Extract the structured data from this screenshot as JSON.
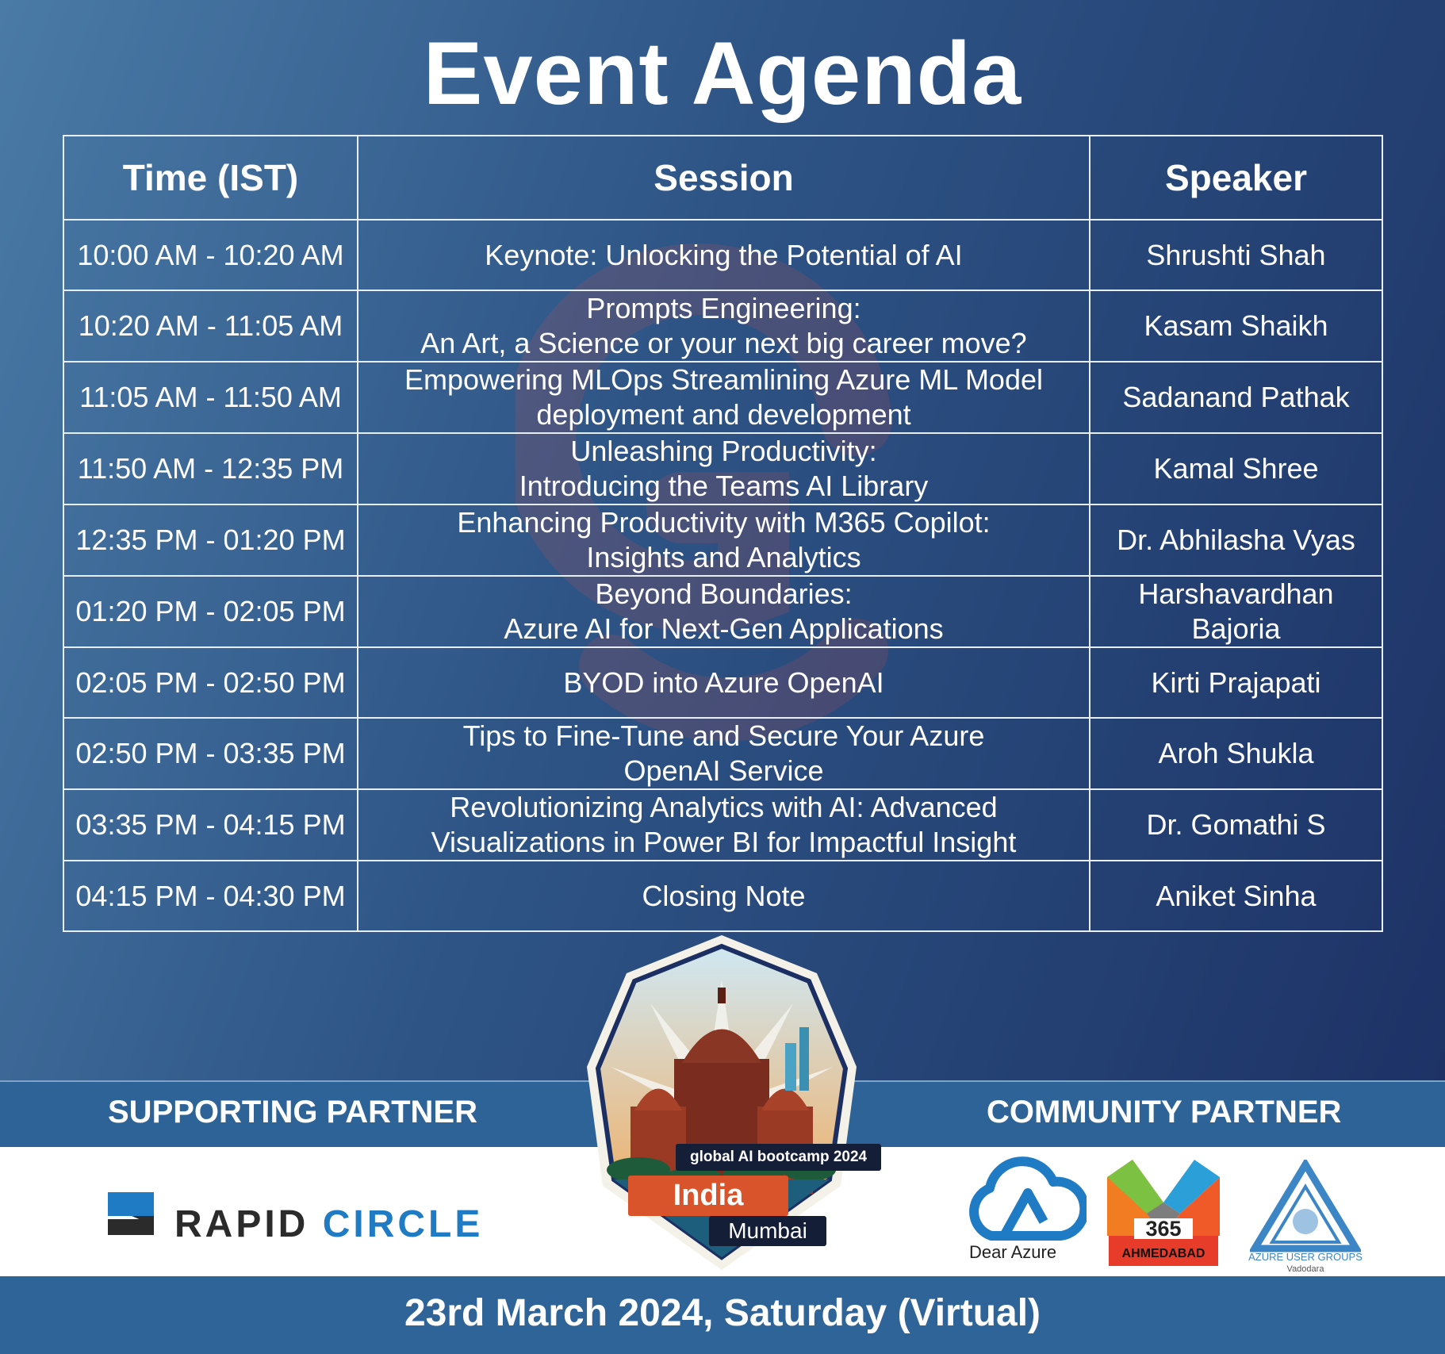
{
  "header": {
    "title": "Event Agenda"
  },
  "table": {
    "columns": [
      "Time (IST)",
      "Session",
      "Speaker"
    ],
    "rows": [
      {
        "time": "10:00 AM - 10:20 AM",
        "session": [
          "Keynote: Unlocking the Potential of AI"
        ],
        "speaker": [
          "Shrushti Shah"
        ]
      },
      {
        "time": "10:20 AM - 11:05 AM",
        "session": [
          "Prompts Engineering:",
          "An Art, a Science or your next big career move?"
        ],
        "speaker": [
          "Kasam Shaikh"
        ]
      },
      {
        "time": "11:05 AM - 11:50 AM",
        "session": [
          "Empowering MLOps Streamlining Azure ML Model",
          "deployment and development"
        ],
        "speaker": [
          "Sadanand Pathak"
        ]
      },
      {
        "time": "11:50 AM - 12:35 PM",
        "session": [
          "Unleashing Productivity:",
          "Introducing the Teams AI Library"
        ],
        "speaker": [
          "Kamal Shree"
        ]
      },
      {
        "time": "12:35 PM - 01:20 PM",
        "session": [
          "Enhancing Productivity with M365 Copilot:",
          "Insights and Analytics"
        ],
        "speaker": [
          "Dr. Abhilasha Vyas"
        ]
      },
      {
        "time": "01:20 PM - 02:05 PM",
        "session": [
          "Beyond Boundaries:",
          "Azure AI for Next-Gen Applications"
        ],
        "speaker": [
          "Harshavardhan",
          "Bajoria"
        ]
      },
      {
        "time": "02:05 PM - 02:50 PM",
        "session": [
          "BYOD into Azure OpenAI"
        ],
        "speaker": [
          "Kirti Prajapati"
        ]
      },
      {
        "time": "02:50 PM - 03:35 PM",
        "session": [
          "Tips to Fine-Tune and Secure Your Azure",
          "OpenAI Service"
        ],
        "speaker": [
          "Aroh Shukla"
        ]
      },
      {
        "time": "03:35 PM - 04:15 PM",
        "session": [
          "Revolutionizing Analytics with AI: Advanced",
          "Visualizations in Power BI for Impactful Insight"
        ],
        "speaker": [
          "Dr. Gomathi S"
        ]
      },
      {
        "time": "04:15 PM - 04:30 PM",
        "session": [
          "Closing Note"
        ],
        "speaker": [
          "Aniket Sinha"
        ]
      }
    ]
  },
  "partners": {
    "supporting_label": "SUPPORTING PARTNER",
    "community_label": "COMMUNITY PARTNER",
    "supporting_logo": {
      "word1": "RAPID",
      "word2": "CIRCLE"
    },
    "community_logos": {
      "dear_azure": "Dear Azure",
      "m365": {
        "number": "365",
        "city": "AHMEDABAD"
      },
      "azure_user_groups": {
        "name": "AZURE USER GROUPS",
        "city": "Vadodara"
      }
    }
  },
  "badge": {
    "event": "global AI bootcamp 2024",
    "country": "India",
    "city": "Mumbai"
  },
  "footer": {
    "date": "23rd March 2024, Saturday (Virtual)"
  },
  "colors": {
    "accent_blue": "#2e6398",
    "rapid_blue": "#1f7bc3",
    "badge_orange": "#d9542b",
    "watermark": "#e0514a"
  }
}
